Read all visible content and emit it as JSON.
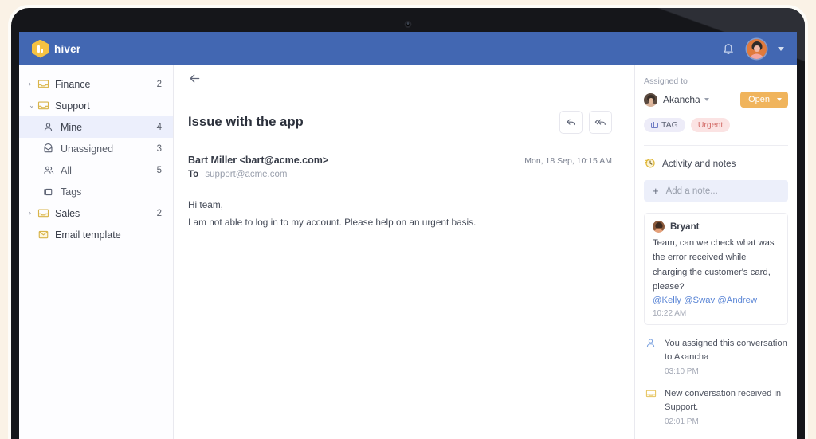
{
  "topbar": {
    "brand": "hiver",
    "notification_icon": "bell-icon",
    "avatar_icon": "user-avatar",
    "caret_icon": "chevron-down-icon"
  },
  "sidebar": {
    "items": [
      {
        "label": "Finance",
        "count": "2",
        "chevron": "›",
        "icon": "inbox-icon",
        "level": "parent",
        "active": false
      },
      {
        "label": "Support",
        "count": "",
        "chevron": "⌄",
        "icon": "inbox-icon",
        "level": "parent",
        "active": false
      },
      {
        "label": "Mine",
        "count": "4",
        "chevron": "",
        "icon": "person-icon",
        "level": "child",
        "active": true
      },
      {
        "label": "Unassigned",
        "count": "3",
        "chevron": "",
        "icon": "unassigned-icon",
        "level": "child",
        "active": false
      },
      {
        "label": "All",
        "count": "5",
        "chevron": "",
        "icon": "people-icon",
        "level": "child",
        "active": false
      },
      {
        "label": "Tags",
        "count": "",
        "chevron": "",
        "icon": "tag-icon",
        "level": "child",
        "active": false
      },
      {
        "label": "Sales",
        "count": "2",
        "chevron": "›",
        "icon": "inbox-icon",
        "level": "parent",
        "active": false
      },
      {
        "label": "Email template",
        "count": "",
        "chevron": "",
        "icon": "template-icon",
        "level": "parent",
        "active": false
      }
    ]
  },
  "conversation": {
    "back_icon": "back-arrow-icon",
    "subject": "Issue with the app",
    "reply_label": "Reply",
    "reply_all_label": "Reply all",
    "from": "Bart Miller <bart@acme.com>",
    "date": "Mon, 18 Sep, 10:15 AM",
    "to_label": "To",
    "to_address": "support@acme.com",
    "body_lines": [
      "Hi team,",
      "I am not able to log in to my account. Please help on an urgent basis."
    ]
  },
  "rightpanel": {
    "assigned_label": "Assigned to",
    "assignee": "Akancha",
    "status": "Open",
    "tags": [
      {
        "label": "TAG",
        "kind": "tag"
      },
      {
        "label": "Urgent",
        "kind": "urgent"
      }
    ],
    "activity_title": "Activity and notes",
    "add_note_placeholder": "Add a note...",
    "note": {
      "author": "Bryant",
      "text": "Team, can we check what was the error received while charging the customer's card, please?",
      "mentions": "@Kelly @Swav @Andrew",
      "time": "10:22 AM"
    },
    "activities": [
      {
        "icon": "person-icon",
        "text": "You assigned this conversation to Akancha",
        "time": "03:10 PM"
      },
      {
        "icon": "inbox-icon",
        "text": "New conversation received in Support.",
        "time": "02:01 PM"
      }
    ]
  },
  "colors": {
    "topbar": "#4267b2",
    "accent_yellow": "#f5c243",
    "status_open": "#f0b45c",
    "tag_chip": "#edecf8",
    "urgent_chip": "#fbe3e3",
    "mention_link": "#5b86d6",
    "active_nav": "#eceffc"
  }
}
